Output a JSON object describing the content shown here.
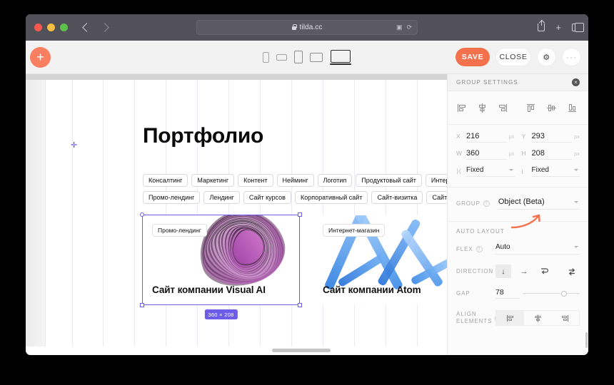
{
  "browser": {
    "url": "tilda.cc",
    "lock_icon": "lock-icon",
    "back_icon": "chevron-left-icon",
    "forward_icon": "chevron-right-icon",
    "reader_icon": "reader-view-icon",
    "reload_icon": "reload-icon",
    "share_icon": "share-icon",
    "newtab_icon": "plus-icon",
    "tabs_icon": "tabs-icon"
  },
  "toolbar": {
    "add_block_label": "+",
    "save_label": "SAVE",
    "close_label": "CLOSE",
    "settings_label": "⚙",
    "more_label": "···",
    "devices": [
      {
        "name": "device-phone-portrait",
        "selected": false
      },
      {
        "name": "device-phone-landscape",
        "selected": false
      },
      {
        "name": "device-tablet-portrait",
        "selected": false
      },
      {
        "name": "device-tablet-landscape",
        "selected": false
      },
      {
        "name": "device-desktop",
        "selected": true
      }
    ]
  },
  "canvas": {
    "page_title": "Портфолио",
    "chips_row1": [
      "Консалтинг",
      "Маркетинг",
      "Контент",
      "Нейминг",
      "Логотип",
      "Продуктовый сайт",
      "Интернет-магазин"
    ],
    "chips_row2": [
      "Промо-лендинг",
      "Лендинг",
      "Сайт курсов",
      "Корпоративный сайт",
      "Сайт-визитка",
      "Сайт-портфолио"
    ],
    "cards": [
      {
        "tag": "Промо-лендинг",
        "caption": "Сайт компании Visual AI",
        "art": "purple-swirl",
        "selected": true
      },
      {
        "tag": "Интернет-магазин",
        "caption": "Сайт компании Atom",
        "art": "blue-ribbon",
        "selected": false
      }
    ],
    "size_badge": "360 × 208",
    "selection_color": "#6c5ce7"
  },
  "panel": {
    "title": "GROUP SETTINGS",
    "close_label": "×",
    "align_buttons": [
      "align-left-icon",
      "align-center-horizontal-icon",
      "align-right-icon",
      "align-top-icon",
      "align-center-vertical-icon",
      "align-bottom-icon"
    ],
    "geometry": {
      "x_label": "X",
      "x_value": "216",
      "x_unit": "px",
      "y_label": "Y",
      "y_value": "293",
      "y_unit": "px",
      "w_label": "W",
      "w_value": "360",
      "w_unit": "px",
      "h_label": "H",
      "h_value": "208",
      "h_unit": "px",
      "width_mode": "Fixed",
      "height_mode": "Fixed"
    },
    "group": {
      "label": "GROUP",
      "value": "Object (Beta)"
    },
    "auto_layout": {
      "header": "AUTO LAYOUT",
      "flex_label": "FLEX",
      "flex_value": "Auto",
      "direction_label": "DIRECTION",
      "directions": [
        {
          "name": "direction-vertical-icon",
          "glyph": "↓",
          "active": true
        },
        {
          "name": "direction-horizontal-icon",
          "glyph": "→",
          "active": false
        },
        {
          "name": "direction-wrap-icon",
          "glyph": "⇄",
          "active": false
        }
      ],
      "reverse_glyph": "⇄",
      "gap_label": "GAP",
      "gap_value": "78",
      "align_elements_label": "ALIGN ELEMENTS",
      "align_element_buttons": [
        {
          "name": "align-elements-start-icon",
          "active": true
        },
        {
          "name": "align-elements-center-icon",
          "active": false
        },
        {
          "name": "align-elements-end-icon",
          "active": false
        }
      ]
    },
    "accent_color": "#f4714e"
  }
}
